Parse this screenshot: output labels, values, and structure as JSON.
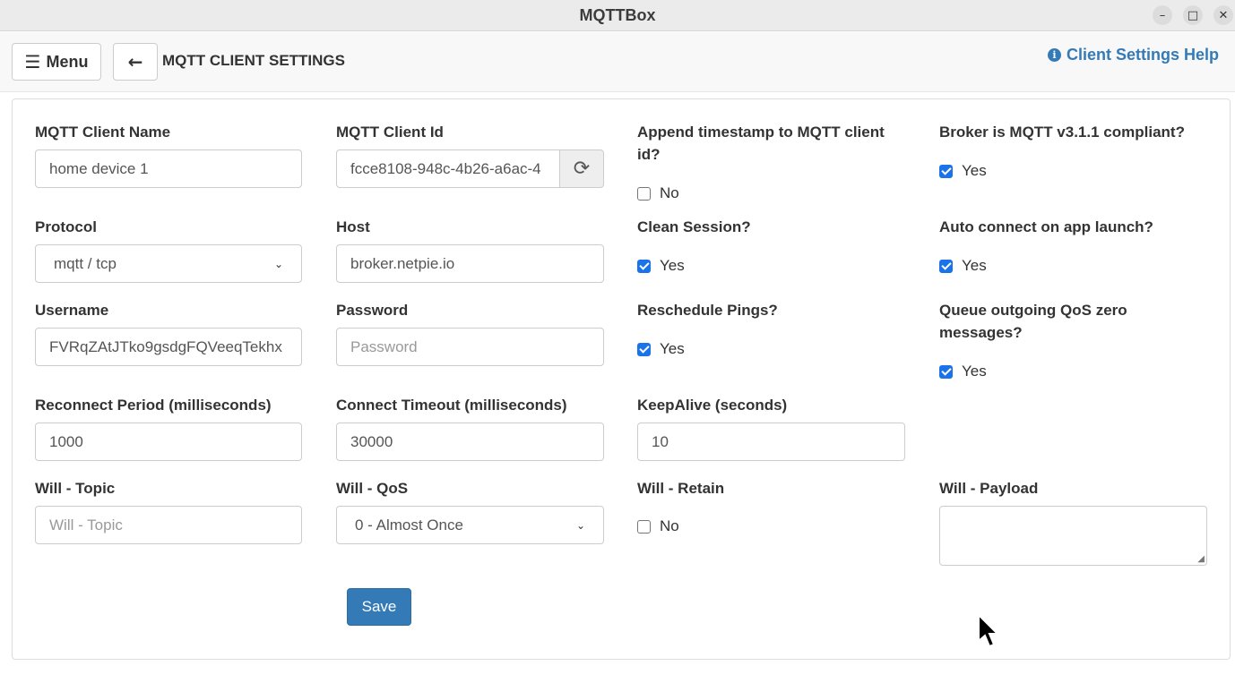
{
  "window": {
    "title": "MQTTBox",
    "minimize": "–",
    "maximize": "□",
    "close": "✕"
  },
  "topbar": {
    "menu_label": "Menu",
    "menu_icon": "☰",
    "back_icon": "🡐",
    "page_title": "MQTT CLIENT SETTINGS",
    "help_label": "Client Settings Help",
    "help_icon": "i"
  },
  "form": {
    "client_name": {
      "label": "MQTT Client Name",
      "value": "home device 1"
    },
    "client_id": {
      "label": "MQTT Client Id",
      "value": "fcce8108-948c-4b26-a6ac-4",
      "refresh_icon": "⟳"
    },
    "append_timestamp": {
      "label": "Append timestamp to MQTT client id?",
      "option": "No",
      "checked": false
    },
    "mqtt_compliant": {
      "label": "Broker is MQTT v3.1.1 compliant?",
      "option": "Yes",
      "checked": true
    },
    "protocol": {
      "label": "Protocol",
      "value": "mqtt / tcp"
    },
    "host": {
      "label": "Host",
      "value": "broker.netpie.io"
    },
    "clean_session": {
      "label": "Clean Session?",
      "option": "Yes",
      "checked": true
    },
    "auto_connect": {
      "label": "Auto connect on app launch?",
      "option": "Yes",
      "checked": true
    },
    "username": {
      "label": "Username",
      "value": "FVRqZAtJTko9gsdgFQVeeqTekhx"
    },
    "password": {
      "label": "Password",
      "placeholder": "Password"
    },
    "reschedule_pings": {
      "label": "Reschedule Pings?",
      "option": "Yes",
      "checked": true
    },
    "queue_qos_zero": {
      "label": "Queue outgoing QoS zero messages?",
      "option": "Yes",
      "checked": true
    },
    "reconnect_period": {
      "label": "Reconnect Period (milliseconds)",
      "value": "1000"
    },
    "connect_timeout": {
      "label": "Connect Timeout (milliseconds)",
      "value": "30000"
    },
    "keepalive": {
      "label": "KeepAlive (seconds)",
      "value": "10"
    },
    "will_topic": {
      "label": "Will - Topic",
      "placeholder": "Will - Topic"
    },
    "will_qos": {
      "label": "Will - QoS",
      "value": "0 - Almost Once"
    },
    "will_retain": {
      "label": "Will - Retain",
      "option": "No",
      "checked": false
    },
    "will_payload": {
      "label": "Will - Payload",
      "value": ""
    },
    "save_label": "Save"
  },
  "colors": {
    "primary": "#337ab7",
    "checkbox": "#1a73e8"
  }
}
